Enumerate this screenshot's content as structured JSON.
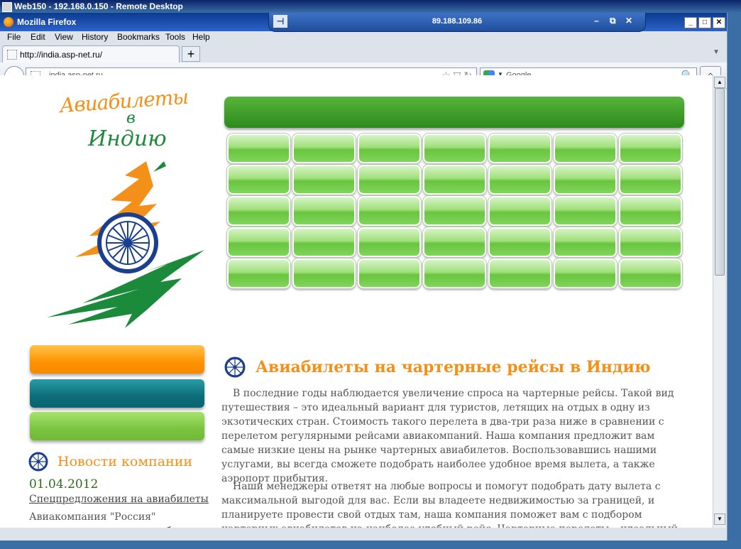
{
  "rdp": {
    "title": "Web150 - 192.168.0.150 - Remote Desktop"
  },
  "firefox": {
    "title": "Mozilla Firefox",
    "connection_ip": "89.188.109.86",
    "menu": [
      "File",
      "Edit",
      "View",
      "History",
      "Bookmarks",
      "Tools",
      "Help"
    ],
    "tab_title": "http://india.asp-net.ru/",
    "new_tab": "+",
    "url": "india.asp-net.ru",
    "search_placeholder": "Google"
  },
  "page": {
    "logo_line1": "Авиабилеты",
    "logo_line2": "в",
    "logo_line3": "Индию",
    "news": {
      "title": "Новости компании",
      "date": "01.04.2012",
      "link": "Спецпредложения на авиабилеты",
      "text": "Авиакомпания \"Россия\" предлагает дешевые авиабилеты в Англию,"
    },
    "heading": "Авиабилеты на чартерные рейсы в Индию",
    "paragraph1": "В последние годы наблюдается увеличение спроса на чартерные рейсы. Такой вид путешествия – это идеальный вариант для туристов, летящих на отдых в одну из экзотических стран. Стоимость такого перелета в два-три раза ниже в сравнении с перелетом регулярными рейсами авиакомпаний. Наша компания предложит вам самые низкие цены на рынке чартерных авиабилетов. Воспользовавшись нашими услугами, вы всегда сможете подобрать наиболее удобное время вылета, а также аэропорт прибытия.",
    "paragraph2": "Наши менеджеры ответят на любые вопросы и помогут подобрать дату вылета с максимальной выгодой для вас. Если вы владеете недвижимостью за границей, и планируете провести свой отдых там, наша компания поможет вам с подбором чартерных авиабилетов на наиболее удобный рейс. Чартерные перелеты – идеальный вариант для поклонников дикого"
  },
  "colors": {
    "accent_orange": "#f39019",
    "accent_green": "#1b8a3a",
    "button_green": "#69c43f",
    "teal": "#0c6d78"
  }
}
